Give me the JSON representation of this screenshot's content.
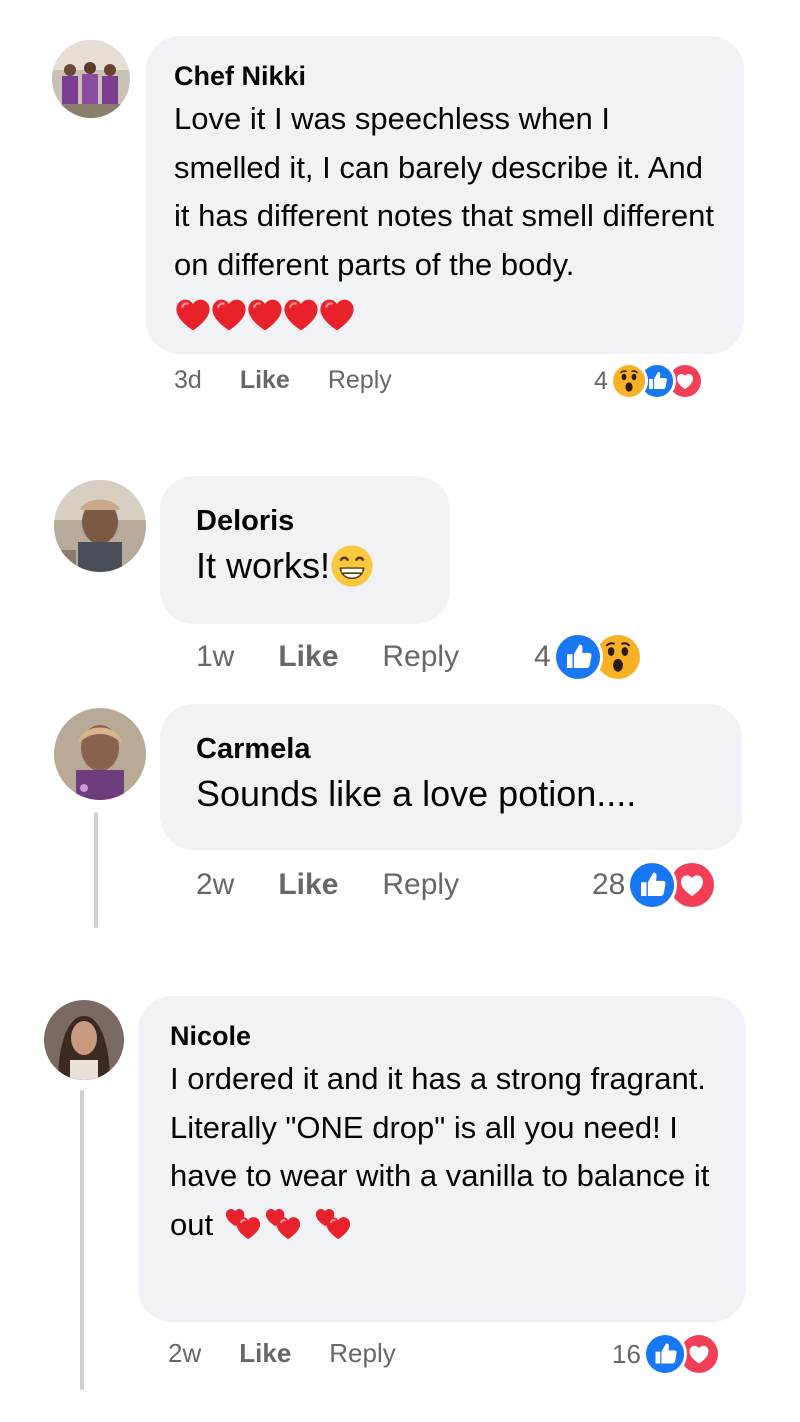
{
  "comments": [
    {
      "author": "Chef Nikki",
      "text": "Love it I was speechless when I smelled it, I can barely describe it. And it has different notes that smell different on different parts of the body.",
      "emoji_name": "red-heart-x5",
      "time": "3d",
      "like_label": "Like",
      "reply_label": "Reply",
      "reaction_count": "4",
      "reactions": [
        "wow",
        "like",
        "love"
      ]
    },
    {
      "author": "Deloris",
      "text": "It works!",
      "emoji_name": "grinning-face",
      "time": "1w",
      "like_label": "Like",
      "reply_label": "Reply",
      "reaction_count": "4",
      "reactions": [
        "like",
        "wow"
      ]
    },
    {
      "author": "Carmela",
      "text": "Sounds like a love potion....",
      "time": "2w",
      "like_label": "Like",
      "reply_label": "Reply",
      "reaction_count": "28",
      "reactions": [
        "like",
        "love"
      ]
    },
    {
      "author": "Nicole",
      "text": "I ordered it and it has a strong fragrant. Literally \"ONE drop\" is all you need! I have to wear with a vanilla to balance it out",
      "emoji_name": "two-hearts-x3",
      "time": "2w",
      "like_label": "Like",
      "reply_label": "Reply",
      "reaction_count": "16",
      "reactions": [
        "like",
        "love"
      ]
    }
  ],
  "colors": {
    "bubble": "#f0f2f5",
    "meta_text": "#65676b",
    "like_blue": "#1877f2",
    "love_red": "#f33e58",
    "wow_yellow": "#f7b125"
  }
}
